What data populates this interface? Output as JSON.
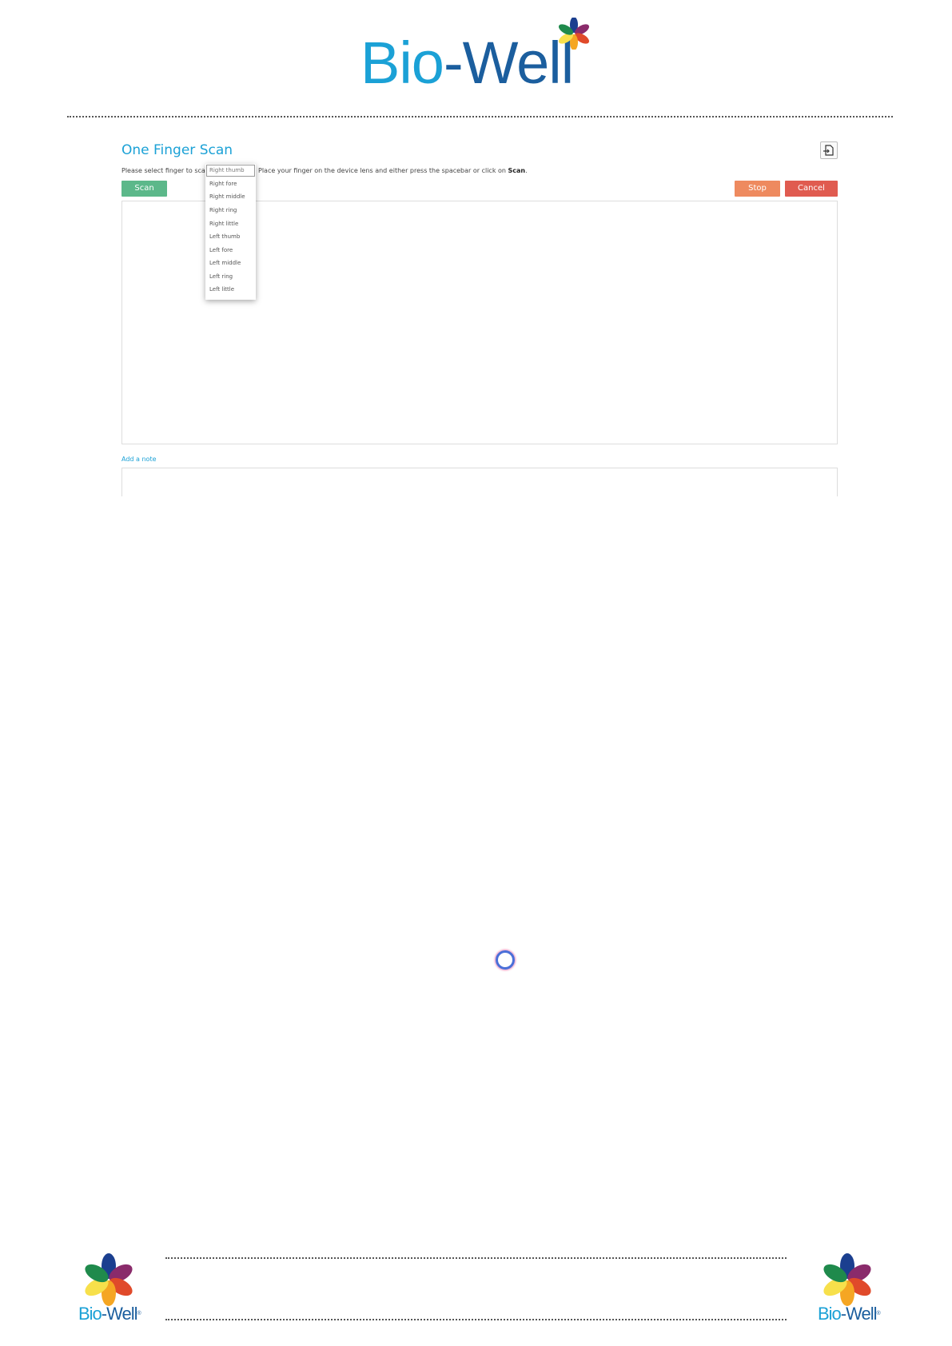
{
  "header": {
    "brand_part1": "Bio",
    "brand_part2": "-Well"
  },
  "app": {
    "title": "One Finger Scan",
    "instruction_prefix": "Please select finger to scan",
    "instruction_suffix": "Place your finger on the device lens and either press the spacebar or click on",
    "instruction_bold": "Scan",
    "instruction_end": "."
  },
  "buttons": {
    "scan": "Scan",
    "stop": "Stop",
    "cancel": "Cancel"
  },
  "finger_select": {
    "selected": "Right thumb",
    "options": [
      "Right fore",
      "Right middle",
      "Right ring",
      "Right little",
      "Left thumb",
      "Left fore",
      "Left middle",
      "Left ring",
      "Left little"
    ]
  },
  "note": {
    "link": "Add a note"
  },
  "footer": {
    "brand_part1": "Bio",
    "brand_part2": "-Well",
    "registered": "®"
  },
  "colors": {
    "accent": "#1ba1d6",
    "brand_dark": "#1b5e9e",
    "scan_button": "#5cb88a",
    "stop_button": "#ee8a5f",
    "cancel_button": "#e05b50"
  },
  "icons": {
    "logo": "bio-well-flower-icon",
    "export": "export-file-icon",
    "loading": "loading-spinner-icon"
  }
}
